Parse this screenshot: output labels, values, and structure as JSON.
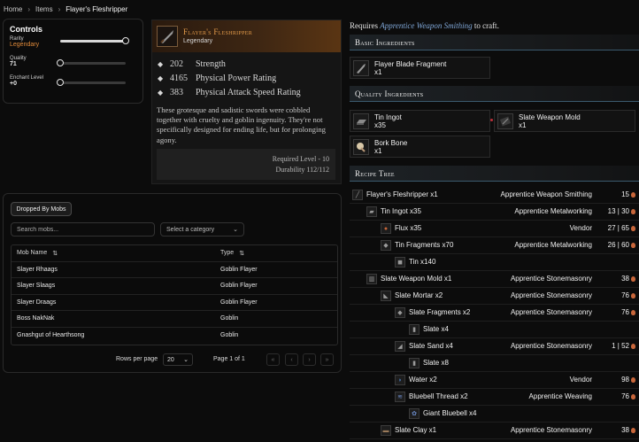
{
  "breadcrumb": [
    "Home",
    "Items",
    "Flayer's Fleshripper"
  ],
  "controls": {
    "title": "Controls",
    "rarity": {
      "label": "Rarity",
      "value": "Legendary",
      "level": 1.0,
      "color": "#e08a3a"
    },
    "quality": {
      "label": "Quality",
      "value": "71",
      "level": 0.0
    },
    "enchant": {
      "label": "Enchant Level",
      "value": "+0",
      "level": 0.0
    }
  },
  "item": {
    "name": "Flayer's Fleshripper",
    "rarity": "Legendary",
    "stats": [
      {
        "value": "202",
        "name": "Strength"
      },
      {
        "value": "4165",
        "name": "Physical Power Rating"
      },
      {
        "value": "383",
        "name": "Physical Attack Speed Rating"
      }
    ],
    "description": "These grotesque and sadistic swords were cobbled together with cruelty and goblin ingenuity. They're not specifically designed for ending life, but for prolonging agony.",
    "required_level": "Required Level - 10",
    "durability": "Durability 112/112"
  },
  "mobs": {
    "tab": "Dropped By Mobs",
    "search_placeholder": "Search mobs...",
    "category_placeholder": "Select a category",
    "columns": [
      "Mob Name",
      "Type"
    ],
    "rows": [
      {
        "name": "Slayer Rhaags",
        "type": "Goblin Flayer"
      },
      {
        "name": "Slayer Slaags",
        "type": "Goblin Flayer"
      },
      {
        "name": "Slayer Draags",
        "type": "Goblin Flayer"
      },
      {
        "name": "Boss NakNak",
        "type": "Goblin"
      },
      {
        "name": "Gnashgut of Hearthsong",
        "type": "Goblin"
      }
    ],
    "rows_per_page_label": "Rows per page",
    "rows_per_page": "20",
    "page_label": "Page 1 of 1"
  },
  "craft": {
    "requires_prefix": "Requires",
    "requires_skill": "Apprentice Weapon Smithing",
    "requires_suffix": "to craft."
  },
  "basic": {
    "title": "Basic Ingredients",
    "items": [
      {
        "name": "Flayer Blade Fragment",
        "qty": "x1"
      }
    ]
  },
  "quality": {
    "title": "Quality Ingredients",
    "items": [
      {
        "name": "Tin Ingot",
        "qty": "x35"
      },
      {
        "name": "Slate Weapon Mold",
        "qty": "x1"
      },
      {
        "name": "Bork Bone",
        "qty": "x1"
      }
    ]
  },
  "recipe_tree": {
    "title": "Recipe Tree",
    "rows": [
      {
        "name": "Flayer's Fleshripper x1",
        "skill": "Apprentice Weapon Smithing",
        "level": "15",
        "depth": 0,
        "icon": "sword-icon"
      },
      {
        "name": "Tin Ingot x35",
        "skill": "Apprentice Metalworking",
        "level": "13 | 30",
        "depth": 1,
        "icon": "ingot-icon"
      },
      {
        "name": "Flux x35",
        "skill": "Vendor",
        "level": "27 | 65",
        "depth": 2,
        "icon": "flux-icon"
      },
      {
        "name": "Tin Fragments x70",
        "skill": "Apprentice Metalworking",
        "level": "26 | 60",
        "depth": 2,
        "icon": "fragment-icon"
      },
      {
        "name": "Tin x140",
        "skill": "",
        "level": "",
        "depth": 3,
        "icon": "ore-icon"
      },
      {
        "name": "Slate Weapon Mold x1",
        "skill": "Apprentice Stonemasonry",
        "level": "38",
        "depth": 1,
        "icon": "mold-icon"
      },
      {
        "name": "Slate Mortar x2",
        "skill": "Apprentice Stonemasonry",
        "level": "76",
        "depth": 2,
        "icon": "mortar-icon"
      },
      {
        "name": "Slate Fragments x2",
        "skill": "Apprentice Stonemasonry",
        "level": "76",
        "depth": 3,
        "icon": "fragment-icon"
      },
      {
        "name": "Slate x4",
        "skill": "",
        "level": "",
        "depth": 4,
        "icon": "slate-icon"
      },
      {
        "name": "Slate Sand x4",
        "skill": "Apprentice Stonemasonry",
        "level": "1 | 52",
        "depth": 3,
        "icon": "sand-icon"
      },
      {
        "name": "Slate x8",
        "skill": "",
        "level": "",
        "depth": 4,
        "icon": "slate-icon"
      },
      {
        "name": "Water x2",
        "skill": "Vendor",
        "level": "98",
        "depth": 3,
        "icon": "water-icon"
      },
      {
        "name": "Bluebell Thread x2",
        "skill": "Apprentice Weaving",
        "level": "76",
        "depth": 3,
        "icon": "thread-icon"
      },
      {
        "name": "Giant Bluebell x4",
        "skill": "",
        "level": "",
        "depth": 4,
        "icon": "flower-icon"
      },
      {
        "name": "Slate Clay x1",
        "skill": "Apprentice Stonemasonry",
        "level": "38",
        "depth": 2,
        "icon": "clay-icon"
      }
    ]
  }
}
